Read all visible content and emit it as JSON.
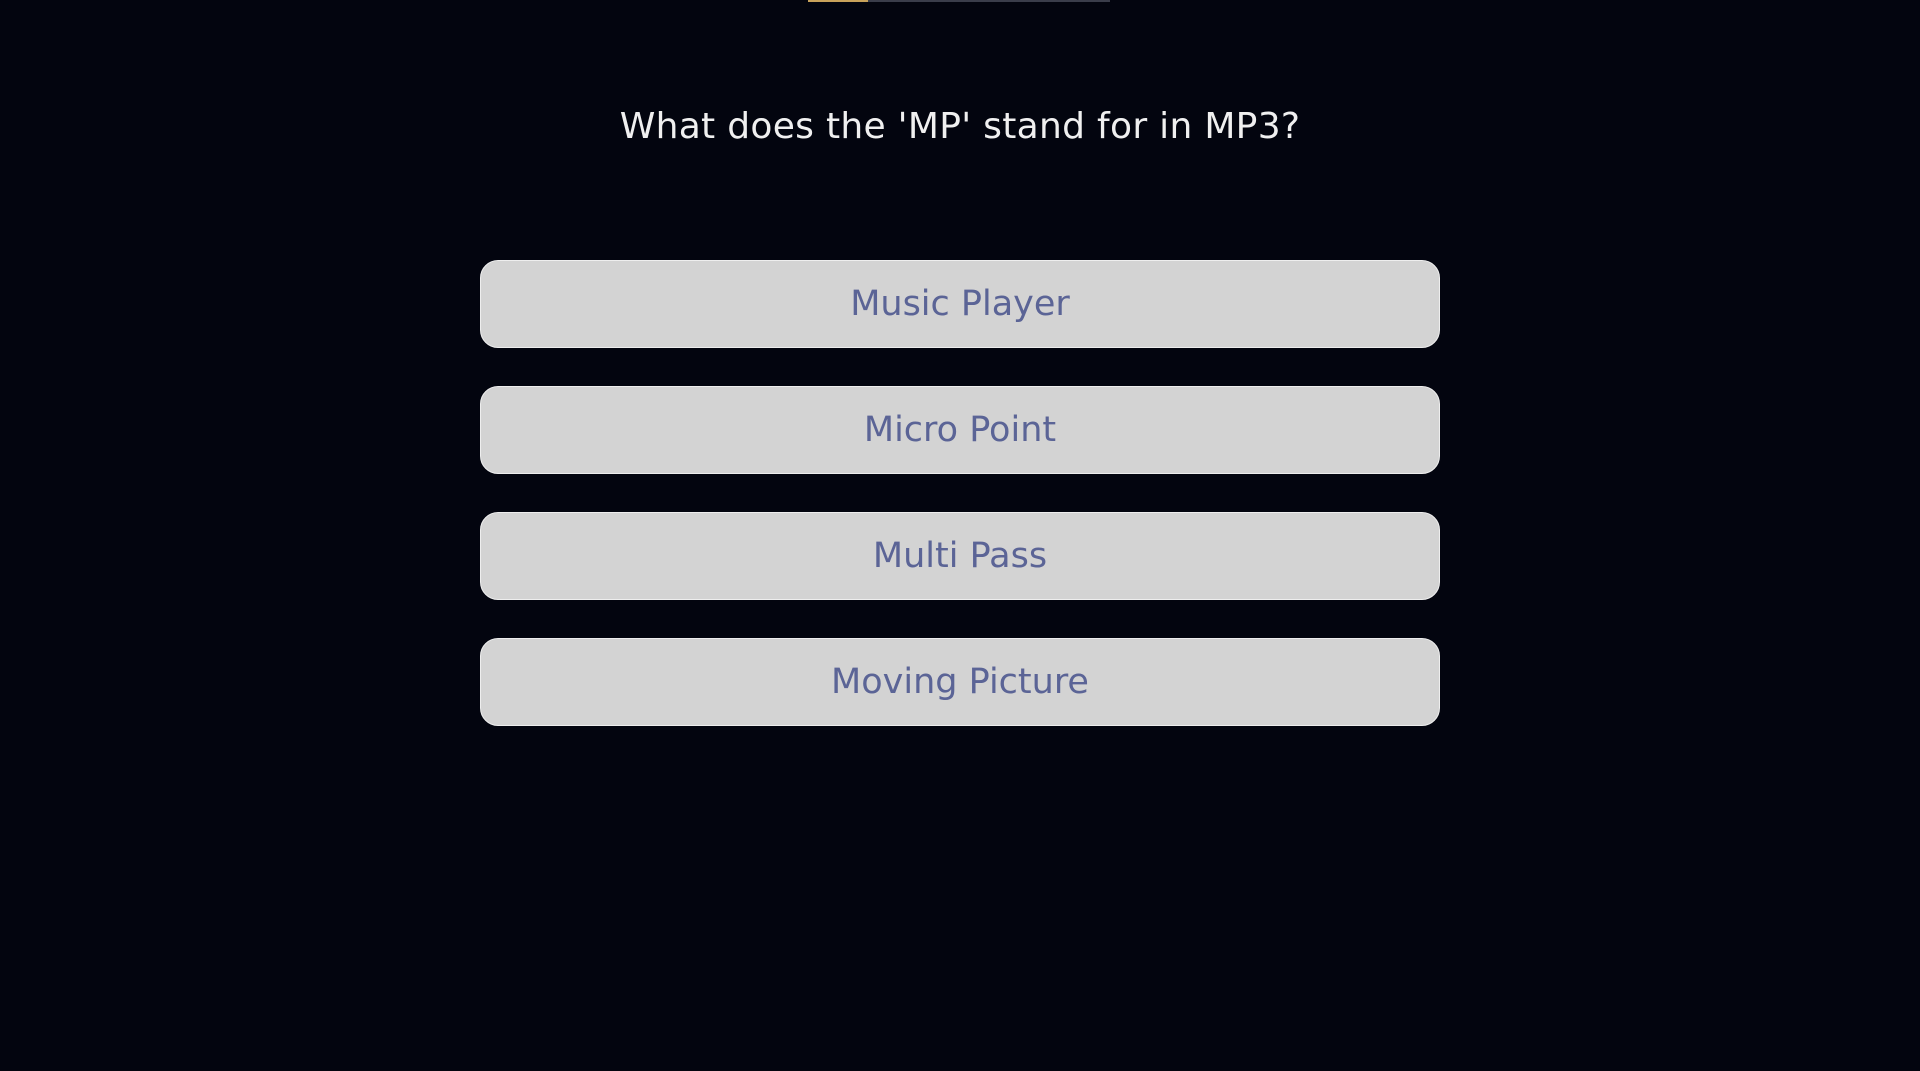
{
  "progress": {
    "fraction": 0.2,
    "track_color": "#3a3d4a",
    "fill_color": "#c8a25a"
  },
  "quiz": {
    "question": "What does the 'MP' stand for in MP3?",
    "options": [
      {
        "label": "Music Player"
      },
      {
        "label": "Micro Point"
      },
      {
        "label": "Multi Pass"
      },
      {
        "label": "Moving Picture"
      }
    ]
  },
  "colors": {
    "background": "#03050f",
    "question_text": "#f0f0f0",
    "option_background": "#d3d3d3",
    "option_text": "#5b6496"
  }
}
